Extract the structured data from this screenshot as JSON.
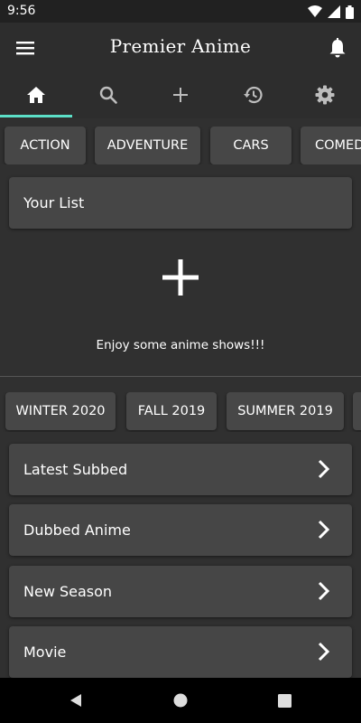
{
  "status_bar": {
    "time": "9:56"
  },
  "app_bar": {
    "title": "Premier Anime",
    "tabs": [
      {
        "icon": "home-icon",
        "selected": true
      },
      {
        "icon": "search-icon",
        "selected": false
      },
      {
        "icon": "add-icon",
        "selected": false
      },
      {
        "icon": "history-icon",
        "selected": false
      },
      {
        "icon": "gear-icon",
        "selected": false
      }
    ],
    "accent_color": "#5ce0c8"
  },
  "genres": [
    "ACTION",
    "ADVENTURE",
    "CARS",
    "COMEDY"
  ],
  "your_list": {
    "title": "Your List",
    "empty_message": "Enjoy some anime shows!!!"
  },
  "seasons": [
    "WINTER 2020",
    "FALL 2019",
    "SUMMER 2019"
  ],
  "sections": [
    "Latest Subbed",
    "Dubbed Anime",
    "New Season",
    "Movie"
  ]
}
